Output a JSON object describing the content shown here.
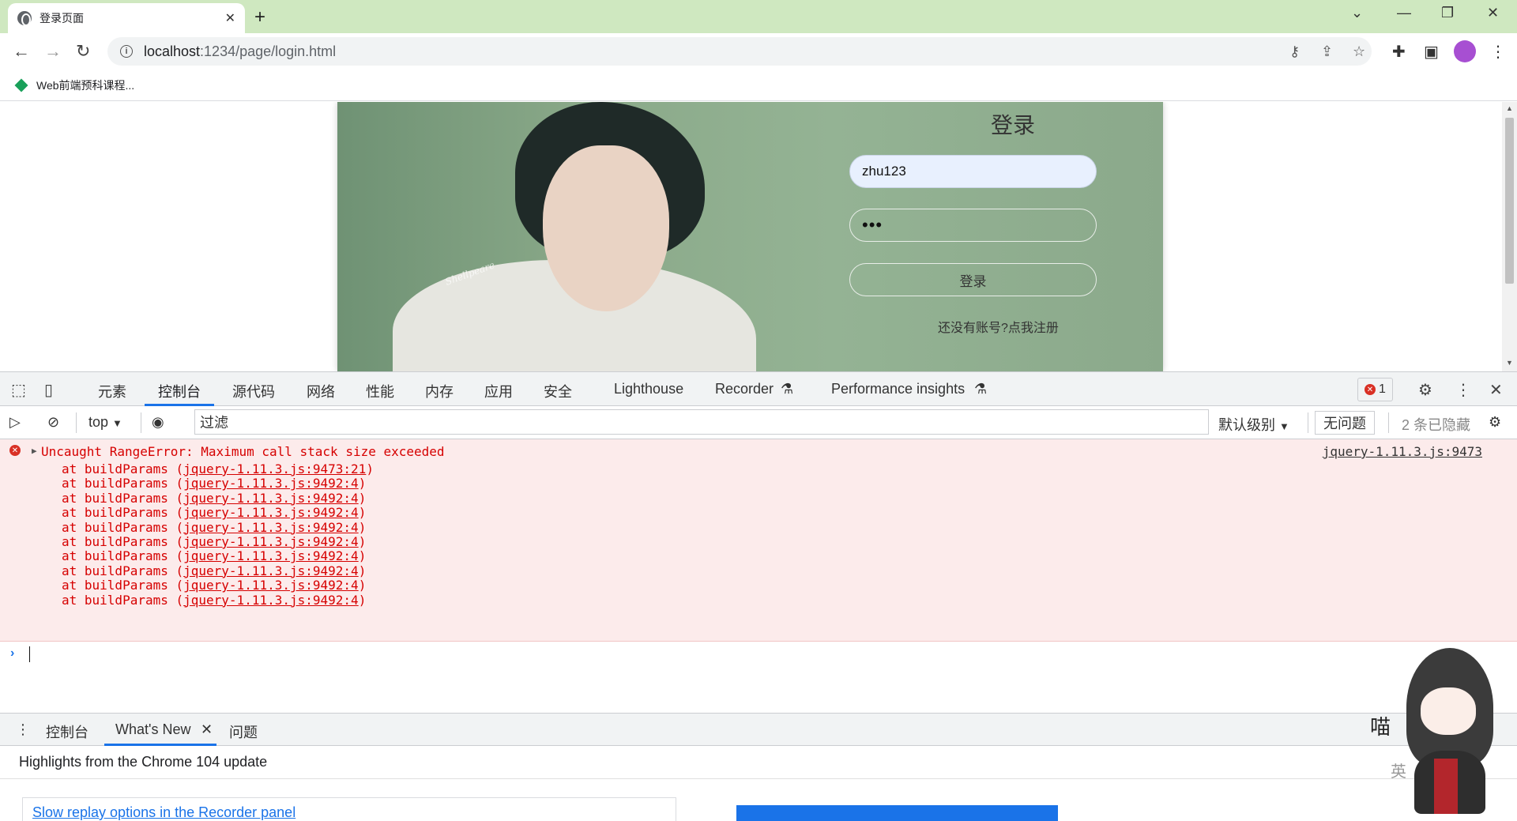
{
  "browser": {
    "tab_title": "登录页面",
    "tab_close": "✕",
    "new_tab": "+",
    "url_host": "localhost",
    "url_path": ":1234/page/login.html",
    "bookmark_label": "Web前端预科课程..."
  },
  "page": {
    "login_title": "登录",
    "username_value": "zhu123",
    "password_value": "•••",
    "login_button": "登录",
    "register_link": "还没有账号?点我注册",
    "watermark": "Shellpeare"
  },
  "devtools": {
    "tabs": [
      "元素",
      "控制台",
      "源代码",
      "网络",
      "性能",
      "内存",
      "应用",
      "安全",
      "Lighthouse",
      "Recorder",
      "Performance insights"
    ],
    "error_count": "1",
    "context": "top",
    "filter_placeholder": "过滤",
    "level": "默认级别",
    "issues_button": "无问题",
    "hidden_count": "2 条已隐藏",
    "error": {
      "message": "Uncaught RangeError: Maximum call stack size exceeded",
      "source": "jquery-1.11.3.js:9473",
      "stack": [
        {
          "prefix": "at buildParams (",
          "link": "jquery-1.11.3.js:9473:21",
          "suffix": ")"
        },
        {
          "prefix": "at buildParams (",
          "link": "jquery-1.11.3.js:9492:4",
          "suffix": ")"
        },
        {
          "prefix": "at buildParams (",
          "link": "jquery-1.11.3.js:9492:4",
          "suffix": ")"
        },
        {
          "prefix": "at buildParams (",
          "link": "jquery-1.11.3.js:9492:4",
          "suffix": ")"
        },
        {
          "prefix": "at buildParams (",
          "link": "jquery-1.11.3.js:9492:4",
          "suffix": ")"
        },
        {
          "prefix": "at buildParams (",
          "link": "jquery-1.11.3.js:9492:4",
          "suffix": ")"
        },
        {
          "prefix": "at buildParams (",
          "link": "jquery-1.11.3.js:9492:4",
          "suffix": ")"
        },
        {
          "prefix": "at buildParams (",
          "link": "jquery-1.11.3.js:9492:4",
          "suffix": ")"
        },
        {
          "prefix": "at buildParams (",
          "link": "jquery-1.11.3.js:9492:4",
          "suffix": ")"
        },
        {
          "prefix": "at buildParams (",
          "link": "jquery-1.11.3.js:9492:4",
          "suffix": ")"
        }
      ]
    },
    "drawer_tabs": [
      "控制台",
      "What's New",
      "问题"
    ],
    "whats_new_heading": "Highlights from the Chrome 104 update",
    "whats_new_card": "Slow replay options in the Recorder panel"
  },
  "mascot": {
    "text1": "喵",
    "text2": "英"
  },
  "colors": {
    "tabstrip": "#cfe8c0",
    "error_bg": "#fcebeb",
    "error_text": "#d60000",
    "accent": "#1a73e8"
  }
}
